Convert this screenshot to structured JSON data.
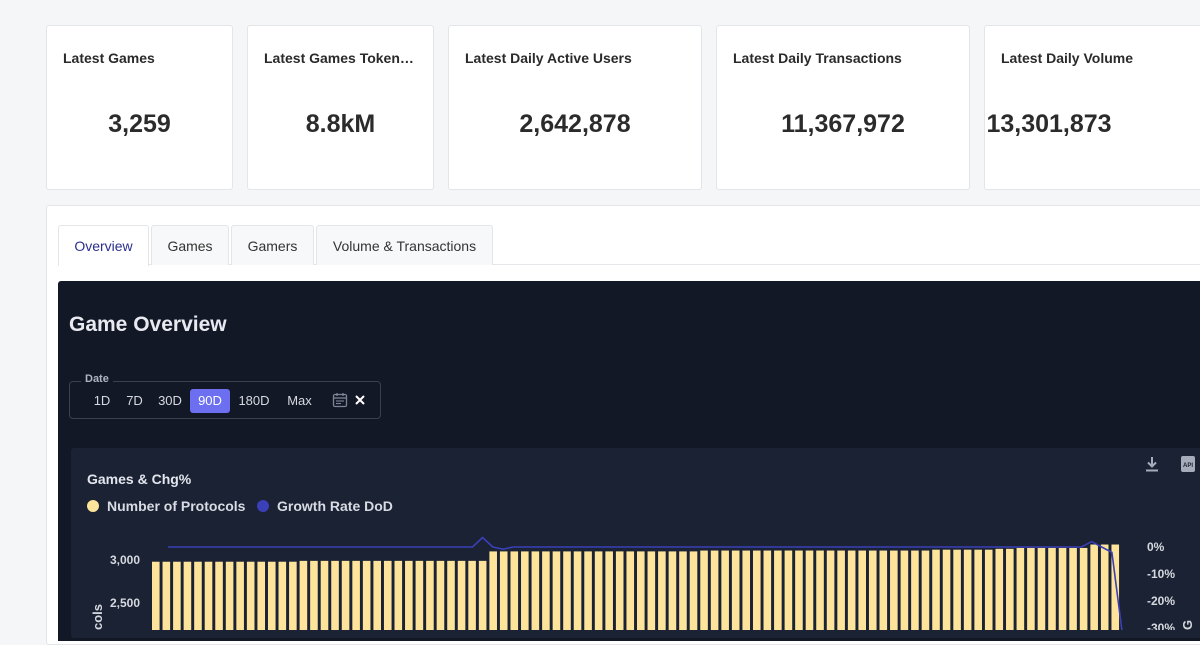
{
  "cards": [
    {
      "label": "Latest Games",
      "value": "3,259"
    },
    {
      "label": "Latest Games Token…",
      "value": "8.8kM"
    },
    {
      "label": "Latest Daily Active Users",
      "value": "2,642,878"
    },
    {
      "label": "Latest Daily Transactions",
      "value": "11,367,972"
    },
    {
      "label": "Latest Daily Volume",
      "value": "13,301,873"
    }
  ],
  "tabs": [
    "Overview",
    "Games",
    "Gamers",
    "Volume & Transactions"
  ],
  "active_tab": "Overview",
  "section_title": "Game Overview",
  "date_filter": {
    "label": "Date",
    "options": [
      "1D",
      "7D",
      "30D",
      "90D",
      "180D",
      "Max"
    ],
    "selected": "90D",
    "calendar_icon": "calendar-icon",
    "clear_icon": "close-icon"
  },
  "toolbar_icons": [
    "download-icon",
    "api-icon"
  ],
  "chart_data": {
    "type": "bar",
    "title": "Games & Chg%",
    "series": [
      {
        "name": "Number of Protocols",
        "type": "bar",
        "color": "#fde49a"
      },
      {
        "name": "Growth Rate DoD",
        "type": "line",
        "color": "#3b3fb8"
      }
    ],
    "y_left": {
      "ticks": [
        "3,000",
        "2,500"
      ],
      "label": "cols"
    },
    "y_right": {
      "ticks": [
        "0%",
        "-10%",
        "-20%",
        "-30%"
      ],
      "label": "G"
    },
    "bar_values": [
      2980,
      2980,
      2980,
      2980,
      2980,
      2980,
      2980,
      2980,
      2980,
      2980,
      2980,
      2980,
      2980,
      2980,
      2990,
      2990,
      2990,
      2990,
      2990,
      2990,
      2990,
      2990,
      2990,
      2990,
      2990,
      2990,
      2990,
      2990,
      2990,
      2990,
      2990,
      2990,
      3100,
      3100,
      3100,
      3100,
      3100,
      3100,
      3100,
      3100,
      3100,
      3100,
      3100,
      3100,
      3100,
      3100,
      3100,
      3100,
      3100,
      3100,
      3100,
      3100,
      3110,
      3110,
      3110,
      3110,
      3110,
      3110,
      3110,
      3110,
      3110,
      3110,
      3110,
      3110,
      3110,
      3110,
      3110,
      3110,
      3110,
      3110,
      3110,
      3110,
      3110,
      3110,
      3120,
      3120,
      3120,
      3120,
      3120,
      3120,
      3130,
      3130,
      3140,
      3140,
      3140,
      3140,
      3140,
      3140,
      3140,
      3180,
      3180,
      3180
    ],
    "growth_values": [
      0,
      0,
      0,
      0,
      0,
      0,
      0,
      0,
      0,
      0,
      0,
      0,
      0,
      0,
      0,
      0,
      0,
      0,
      0,
      0,
      0,
      0,
      0,
      0,
      0,
      0,
      0,
      0,
      0,
      0,
      0,
      3.5,
      0,
      -0.8,
      0,
      0,
      0,
      0,
      0,
      0,
      0,
      0,
      0,
      0,
      0,
      0,
      0,
      0,
      0,
      0,
      0,
      0,
      0,
      0,
      0,
      0,
      0,
      0,
      0,
      0,
      0,
      0,
      0,
      0,
      0,
      0,
      0,
      0,
      0,
      0,
      0,
      0,
      0,
      0,
      0,
      0,
      0,
      0,
      0,
      0,
      0,
      0,
      0,
      0,
      0,
      0,
      0,
      0,
      0,
      0,
      0,
      2,
      0,
      -2,
      -31
    ]
  }
}
